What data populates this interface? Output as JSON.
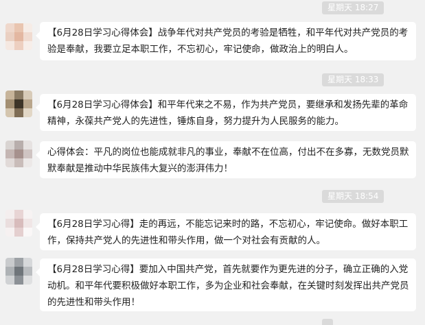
{
  "messages": [
    {
      "timestamp": "星期天 18:27",
      "text": "【6月28日学习心得体会】战争年代对共产党员的考验是牺牲，和平年代对共产党员的考验是奉献，我要立足本职工作，不忘初心，牢记使命，做政治上的明白人。"
    },
    {
      "timestamp": "星期天 18:33",
      "text": "【6月28日学习心得体会】和平年代来之不易，作为共产党员，要继承和发扬先辈的革命精神，永葆共产党人的先进性，锤炼自身，努力提升为人民服务的能力。"
    },
    {
      "timestamp": "",
      "text": "心得体会：平凡的岗位也能成就非凡的事业，奉献不在位高，付出不在多寡，无数党员默默奉献是推动中华民族伟大复兴的澎湃伟力！"
    },
    {
      "timestamp": "星期天 18:54",
      "text": "【6月28日学习心得】走的再远，不能忘记来时的路，不忘初心，牢记使命。做好本职工作，保持共产党人的先进性和带头作用，做一个对社会有贡献的人。"
    },
    {
      "timestamp": "",
      "text": "【6月28日学习心得】要加入中国共产党，首先就要作为更先进的分子，确立正确的入党动机。和平年代要积极做好本职工作，多为企业和社会奉献，在关键时刻发挥出共产党员的先进性和带头作用！"
    }
  ]
}
